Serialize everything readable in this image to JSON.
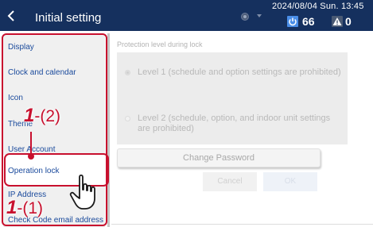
{
  "header": {
    "back_icon": "chevron-left-icon",
    "title": "Initial setting",
    "datetime": "2024/08/04 Sun. 13:45",
    "power_count": "66",
    "alert_count": "0",
    "colors": {
      "bar": "#15305e",
      "power": "#4a8ee8"
    }
  },
  "sidebar": {
    "items": [
      {
        "label": "Display"
      },
      {
        "label": "Clock and calendar"
      },
      {
        "label": "Icon"
      },
      {
        "label": "Theme"
      },
      {
        "label": "User Account"
      },
      {
        "label": "Operation lock",
        "selected": true
      },
      {
        "label": "IP Address"
      },
      {
        "label": "Check Code email address"
      }
    ]
  },
  "main": {
    "section_title": "Protection level during lock",
    "options": [
      {
        "label": "Level 1 (schedule and option settings are prohibited)",
        "selected": true
      },
      {
        "label": "Level 2 (schedule, option, and indoor unit settings are prohibited)",
        "selected": false
      }
    ],
    "change_password_label": "Change Password",
    "cancel_label": "Cancel",
    "ok_label": "OK"
  },
  "annotations": {
    "step_upper_num": "1",
    "step_upper_sub": "-(2)",
    "step_lower_num": "1",
    "step_lower_sub": "-(1)",
    "color": "#c8102e"
  }
}
